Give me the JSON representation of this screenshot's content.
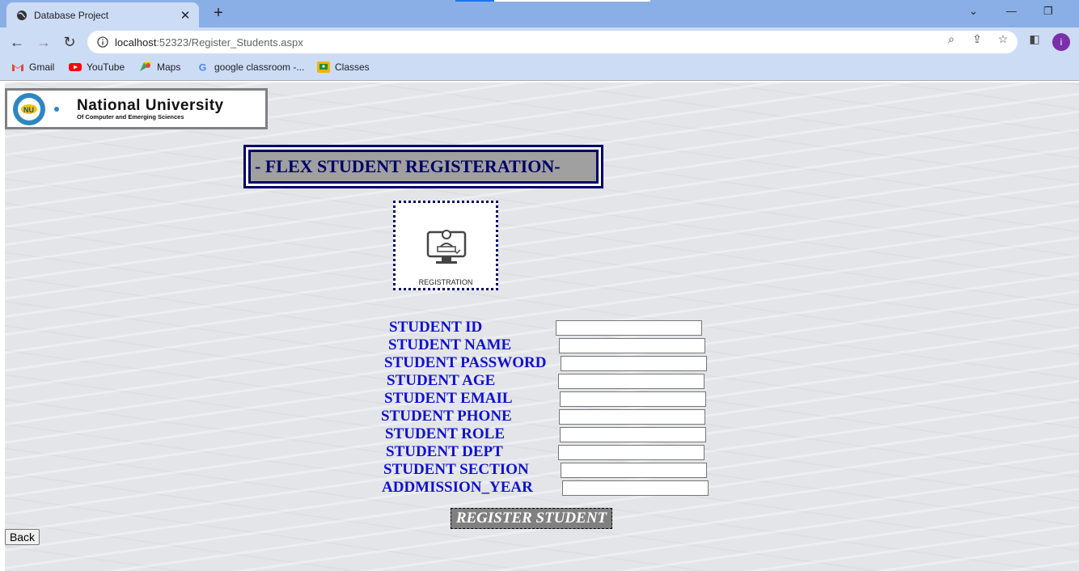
{
  "browser": {
    "tab_title": "Database Project",
    "tab_close": "✕",
    "new_tab": "+",
    "url_host": "localhost",
    "url_path": ":52323/Register_Students.aspx",
    "avatar_letter": "i",
    "bookmarks": [
      {
        "label": "Gmail",
        "icon": "gmail-icon",
        "color": "#ea4335"
      },
      {
        "label": "YouTube",
        "icon": "youtube-icon",
        "color": "#ff0000"
      },
      {
        "label": "Maps",
        "icon": "maps-icon",
        "color": "#34a853"
      },
      {
        "label": "google classroom -...",
        "icon": "google-icon",
        "color": "#4285f4"
      },
      {
        "label": "Classes",
        "icon": "classroom-icon",
        "color": "#f4b400"
      }
    ]
  },
  "page": {
    "logo_title": "National University",
    "logo_subtitle": "Of Computer and Emerging Sciences",
    "heading": "- FLEX STUDENT REGISTERATION-",
    "image_caption": "REGISTRATION",
    "fields": [
      {
        "label": "STUDENT ID",
        "value": ""
      },
      {
        "label": "STUDENT NAME",
        "value": ""
      },
      {
        "label": "STUDENT PASSWORD",
        "value": ""
      },
      {
        "label": "STUDENT AGE",
        "value": ""
      },
      {
        "label": "STUDENT EMAIL",
        "value": ""
      },
      {
        "label": "STUDENT PHONE",
        "value": ""
      },
      {
        "label": "STUDENT ROLE",
        "value": ""
      },
      {
        "label": "STUDENT DEPT",
        "value": ""
      },
      {
        "label": "STUDENT SECTION",
        "value": ""
      },
      {
        "label": "ADDMISSION_YEAR",
        "value": ""
      }
    ],
    "register_button": "REGISTER STUDENT",
    "back_button": "Back"
  },
  "colors": {
    "heading_navy": "#000066",
    "label_blue": "#1010d0",
    "chrome_blue": "#cddcf5"
  }
}
